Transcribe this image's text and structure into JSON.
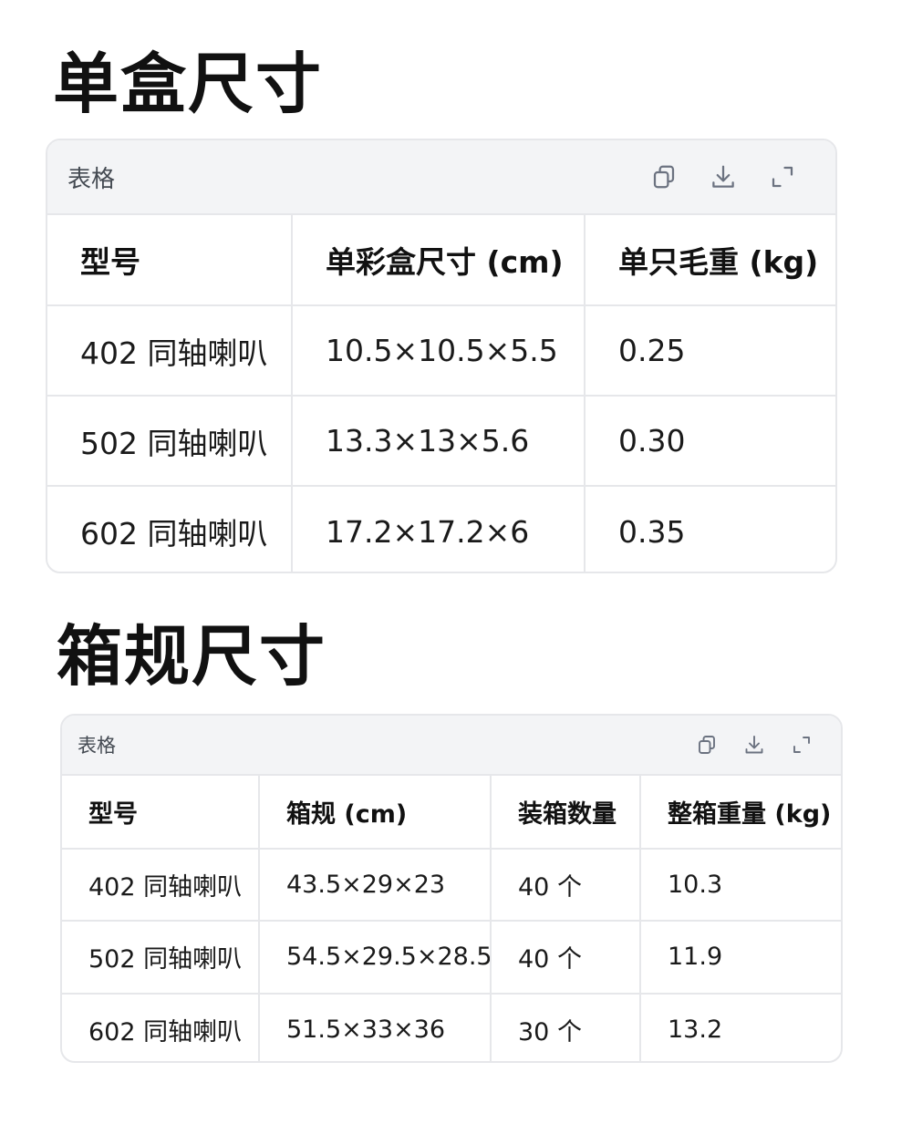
{
  "sections": [
    {
      "title": "单盒尺寸",
      "card_label": "表格",
      "toolbar": {
        "copy_icon": "copy-icon",
        "download_icon": "download-icon",
        "expand_icon": "expand-icon"
      },
      "columns": [
        "型号",
        "单彩盒尺寸 (cm)",
        "单只毛重 (kg)"
      ],
      "rows": [
        [
          "402 同轴喇叭",
          "10.5×10.5×5.5",
          "0.25"
        ],
        [
          "502 同轴喇叭",
          "13.3×13×5.6",
          "0.30"
        ],
        [
          "602 同轴喇叭",
          "17.2×17.2×6",
          "0.35"
        ]
      ]
    },
    {
      "title": "箱规尺寸",
      "card_label": "表格",
      "toolbar": {
        "copy_icon": "copy-icon",
        "download_icon": "download-icon",
        "expand_icon": "expand-icon"
      },
      "columns": [
        "型号",
        "箱规 (cm)",
        "装箱数量",
        "整箱重量 (kg)"
      ],
      "rows": [
        [
          "402 同轴喇叭",
          "43.5×29×23",
          "40 个",
          "10.3"
        ],
        [
          "502 同轴喇叭",
          "54.5×29.5×28.5",
          "40 个",
          "11.9"
        ],
        [
          "602 同轴喇叭",
          "51.5×33×36",
          "30 个",
          "13.2"
        ]
      ]
    }
  ],
  "colors": {
    "header_bg": "#f3f4f6",
    "border": "#e6e7ea",
    "icon": "#6b7280",
    "text": "#1a1a1a"
  }
}
